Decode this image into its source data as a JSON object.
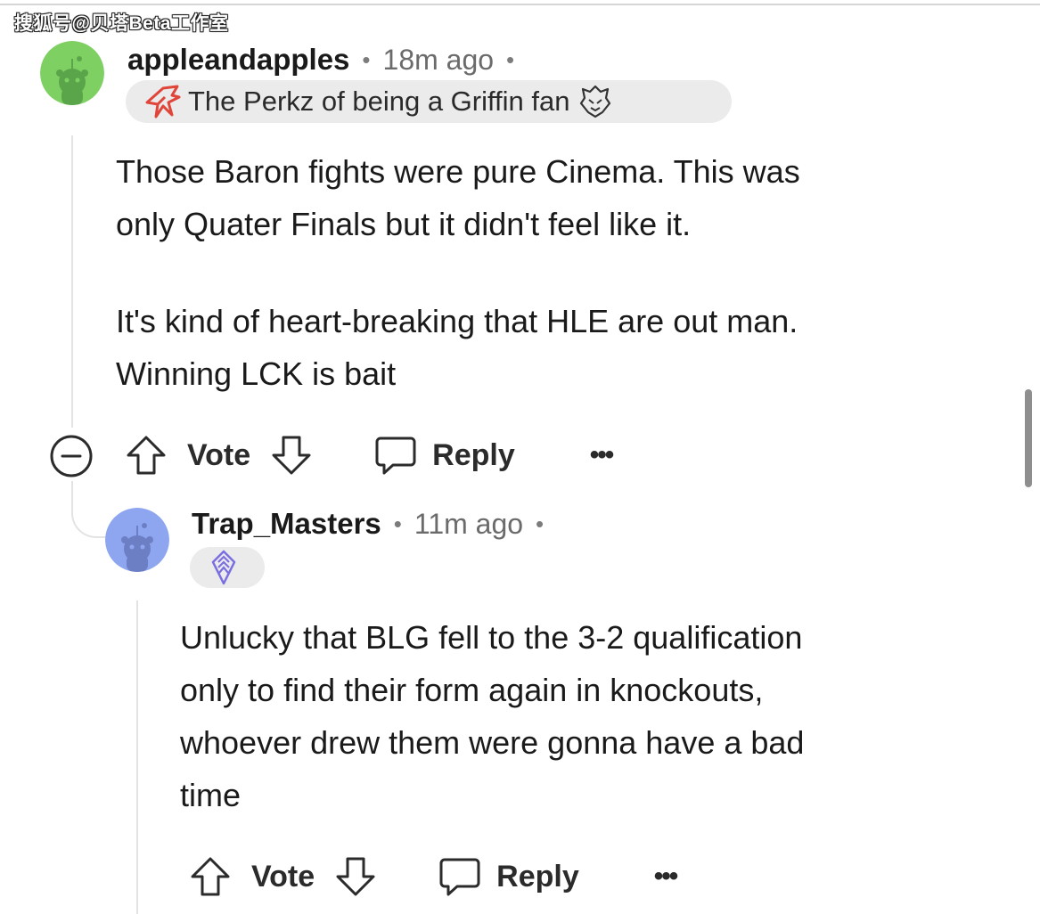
{
  "watermark": "搜狐号@贝塔Beta工作室",
  "comments": [
    {
      "username": "appleandapples",
      "separator": "•",
      "time": "18m ago",
      "flair_text": "The Perkz of being a Griffin fan",
      "paragraphs": [
        [
          "Those Baron fights were pure Cinema. This was",
          "only Quater Finals but it didn't feel like it."
        ],
        [
          "It's kind of heart-breaking that HLE are out man.",
          "Winning LCK is bait"
        ]
      ],
      "actions": {
        "vote_label": "Vote",
        "reply_label": "Reply",
        "more_label": "•••"
      },
      "avatar_color": "#7fd063"
    },
    {
      "username": "Trap_Masters",
      "separator": "•",
      "time": "11m ago",
      "flair_text": "",
      "paragraphs": [
        [
          "Unlucky that BLG fell to the 3-2 qualification",
          "only to find their form again in knockouts,",
          "whoever drew them were gonna have a bad",
          "time"
        ]
      ],
      "actions": {
        "vote_label": "Vote",
        "reply_label": "Reply",
        "more_label": "•••"
      },
      "avatar_color": "#8ea5f0"
    }
  ],
  "icons": {
    "collapse": "minus-circle-icon",
    "upvote": "arrow-up-icon",
    "downvote": "arrow-down-icon",
    "reply": "speech-bubble-icon",
    "more": "ellipsis-icon",
    "flair_left": "griffin-logo-icon",
    "flair_right": "g2-logo-icon",
    "flair_lol": "lol-logo-icon"
  },
  "colors": {
    "text": "#1a1a1b",
    "meta": "#6b6b6b",
    "flair_bg": "#ebebeb",
    "griffin_red": "#e0453a",
    "lol_purple": "#7a6fe0"
  }
}
